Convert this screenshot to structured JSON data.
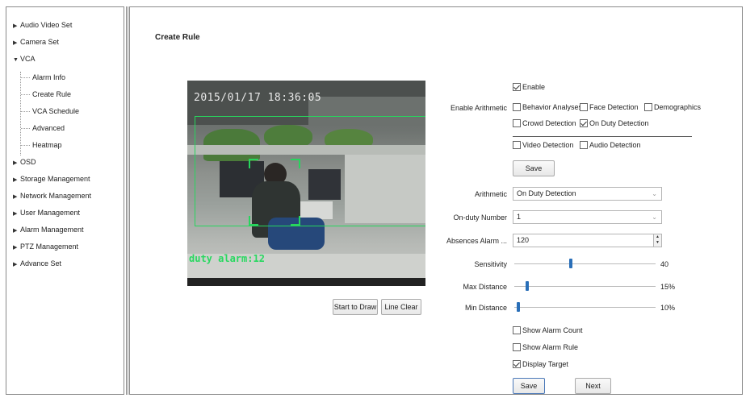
{
  "sidebar": {
    "items": [
      {
        "label": "Audio Video Set"
      },
      {
        "label": "Camera Set"
      },
      {
        "label": "VCA"
      },
      {
        "label": "OSD"
      },
      {
        "label": "Storage Management"
      },
      {
        "label": "Network Management"
      },
      {
        "label": "User Management"
      },
      {
        "label": "Alarm Management"
      },
      {
        "label": "PTZ Management"
      },
      {
        "label": "Advance Set"
      }
    ],
    "vca_children": [
      {
        "label": "Alarm Info"
      },
      {
        "label": "Create Rule"
      },
      {
        "label": "VCA Schedule"
      },
      {
        "label": "Advanced"
      },
      {
        "label": "Heatmap"
      }
    ]
  },
  "page": {
    "title": "Create Rule"
  },
  "video": {
    "timestamp": "2015/01/17 18:36:05",
    "overlay_text": "duty alarm:12",
    "overlay_color": "#27d55d"
  },
  "video_buttons": {
    "draw": "Start to Draw",
    "clear": "Line Clear"
  },
  "form": {
    "enable": {
      "label": "Enable",
      "checked": true
    },
    "enable_arithmetic_label": "Enable Arithmetic",
    "arithmetics": [
      {
        "label": "Behavior Analyses",
        "checked": false
      },
      {
        "label": "Face Detection",
        "checked": false
      },
      {
        "label": "Demographics",
        "checked": false
      },
      {
        "label": "Crowd Detection",
        "checked": false
      },
      {
        "label": "On Duty Detection",
        "checked": true
      }
    ],
    "video_detection": {
      "label": "Video Detection",
      "checked": false
    },
    "audio_detection": {
      "label": "Audio Detection",
      "checked": false
    },
    "save_label": "Save",
    "arithmetic": {
      "label": "Arithmetic",
      "value": "On Duty Detection"
    },
    "on_duty_number": {
      "label": "On-duty Number",
      "value": "1"
    },
    "absences_alarm": {
      "label": "Absences Alarm ...",
      "value": "120"
    },
    "sensitivity": {
      "label": "Sensitivity",
      "value": "40",
      "level": 0.4
    },
    "max_distance": {
      "label": "Max Distance",
      "value": "15%",
      "level": 0.08
    },
    "min_distance": {
      "label": "Min Distance",
      "value": "10%",
      "level": 0.02
    },
    "show_alarm_count": {
      "label": "Show Alarm Count",
      "checked": false
    },
    "show_alarm_rule": {
      "label": "Show Alarm Rule",
      "checked": false
    },
    "display_target": {
      "label": "Display Target",
      "checked": true
    },
    "bottom_save_label": "Save",
    "next_label": "Next"
  },
  "colors": {
    "slider_thumb": "#2a6fb8",
    "border": "#8a8a8a"
  }
}
